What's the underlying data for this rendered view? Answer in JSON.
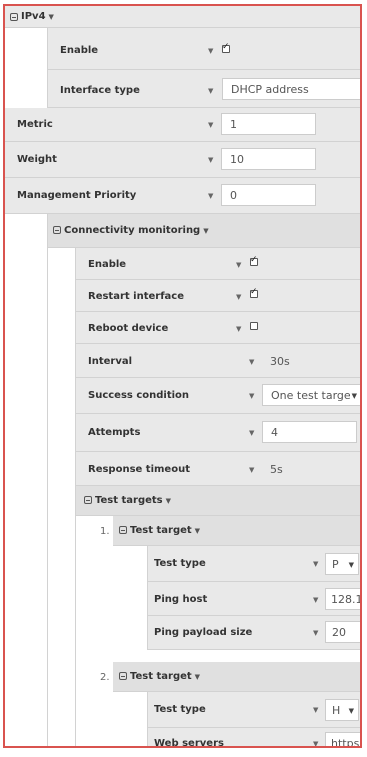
{
  "ipv4": {
    "title": "IPv4",
    "enable_label": "Enable",
    "enable_checked": true,
    "interface_type_label": "Interface type",
    "interface_type_value": "DHCP address",
    "metric_label": "Metric",
    "metric_value": "1",
    "weight_label": "Weight",
    "weight_value": "10",
    "mgmt_priority_label": "Management Priority",
    "mgmt_priority_value": "0"
  },
  "connectivity": {
    "title": "Connectivity monitoring",
    "enable_label": "Enable",
    "enable_checked": true,
    "restart_label": "Restart interface",
    "restart_checked": true,
    "reboot_label": "Reboot device",
    "reboot_checked": false,
    "interval_label": "Interval",
    "interval_value": "30s",
    "success_label": "Success condition",
    "success_value": "One test targe",
    "attempts_label": "Attempts",
    "attempts_value": "4",
    "timeout_label": "Response timeout",
    "timeout_value": "5s"
  },
  "test_targets": {
    "title": "Test targets",
    "targets": [
      {
        "number": "1.",
        "title": "Test target",
        "test_type_label": "Test type",
        "test_type_value": "P",
        "ping_host_label": "Ping host",
        "ping_host_value": "128.1",
        "payload_label": "Ping payload size",
        "payload_value": "20"
      },
      {
        "number": "2.",
        "title": "Test target",
        "test_type_label": "Test type",
        "test_type_value": "H",
        "web_servers_label": "Web servers",
        "web_servers_value": "https"
      }
    ]
  }
}
